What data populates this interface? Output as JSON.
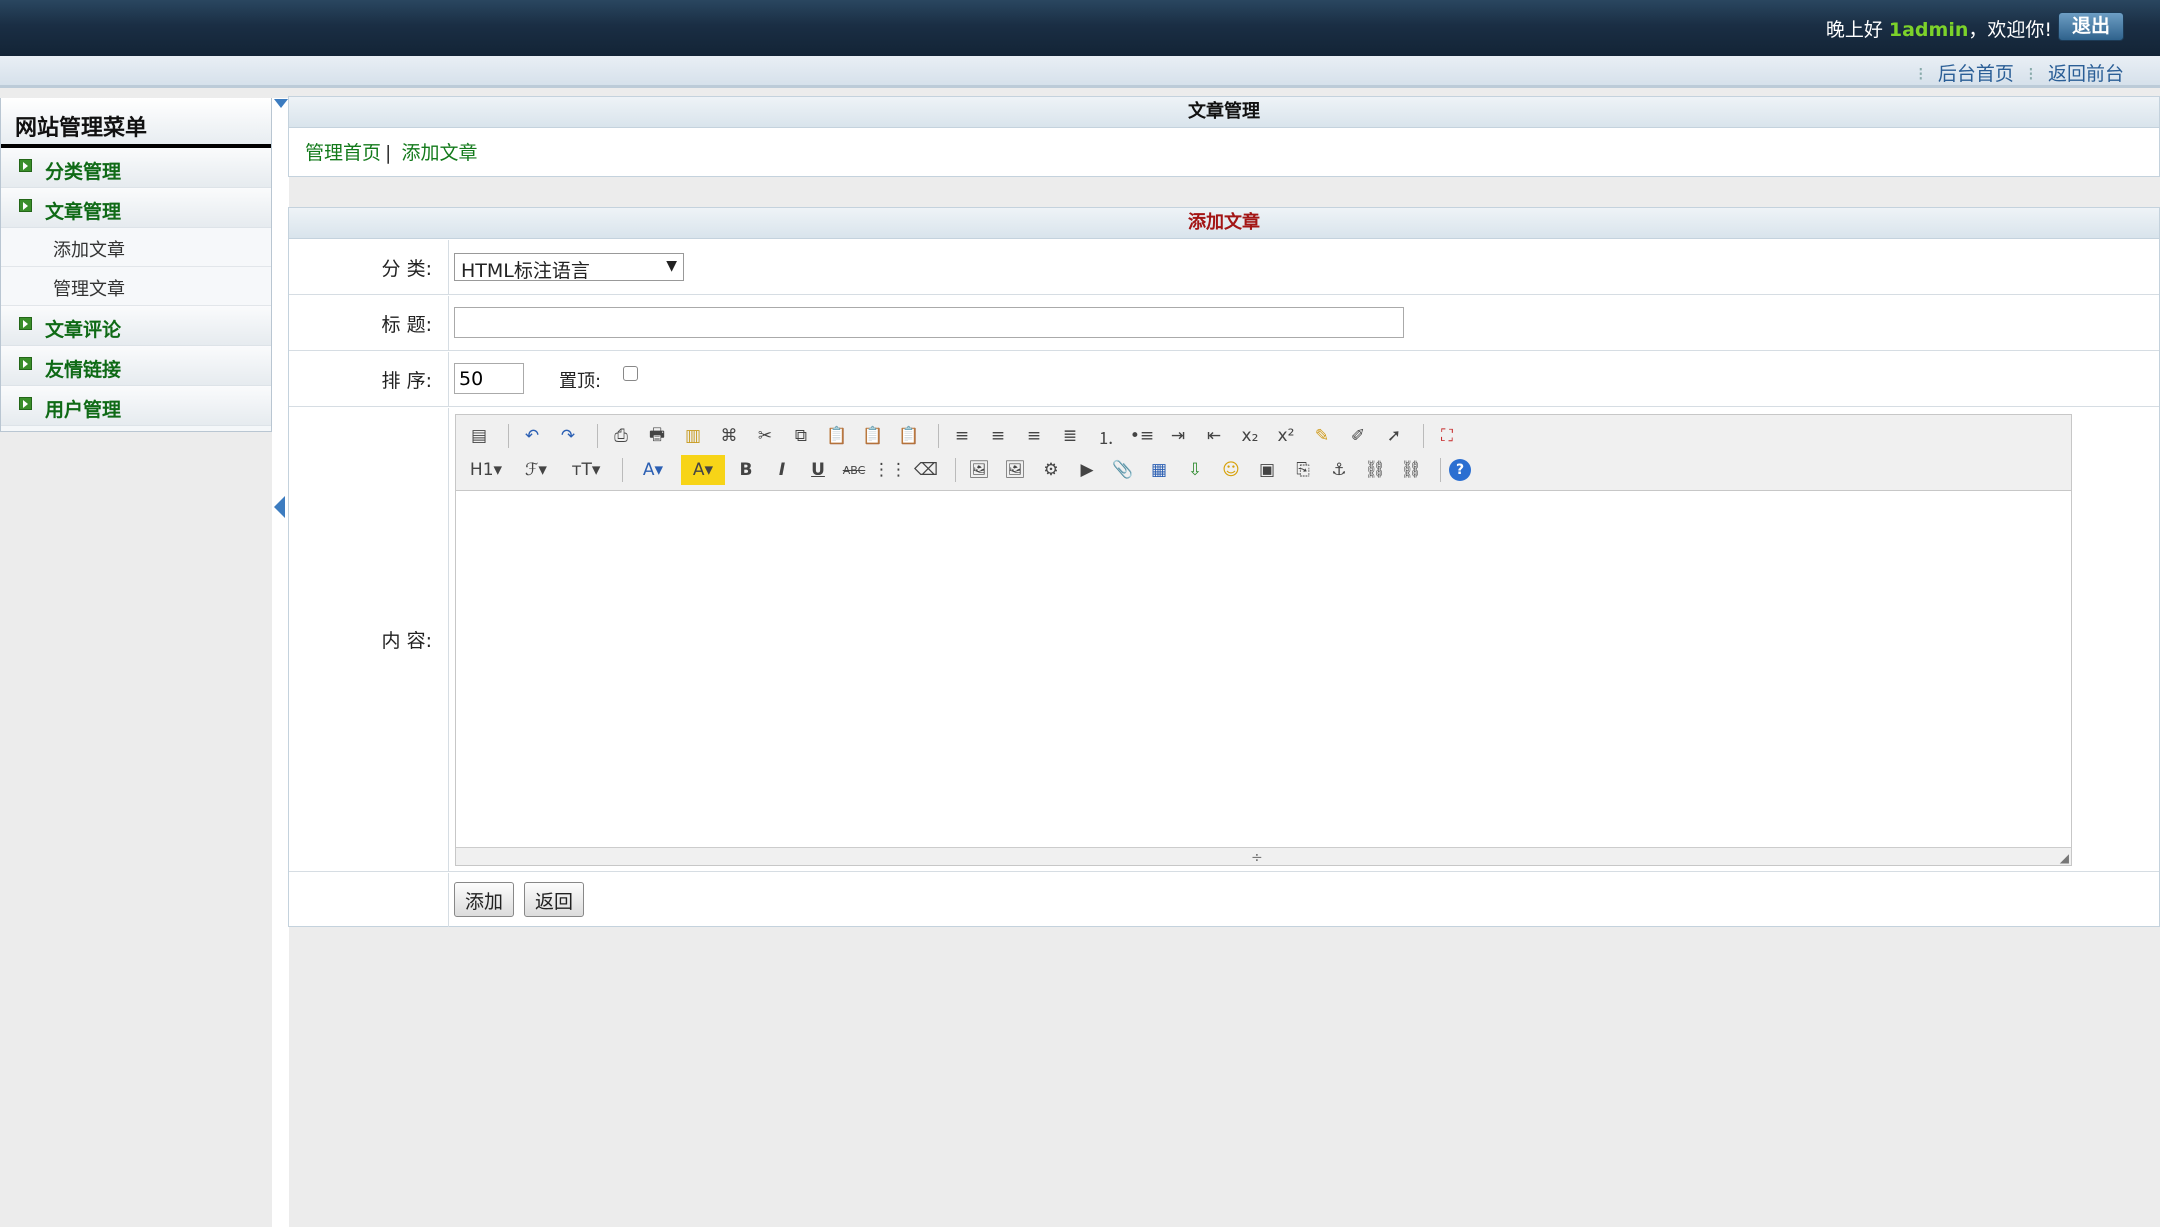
{
  "header": {
    "greeting_prefix": "晚上好",
    "username": "1admin",
    "greeting_suffix": "，欢迎你!",
    "logout_label": "退出",
    "links": [
      "后台首页",
      "返回前台"
    ]
  },
  "sidebar": {
    "title": "网站管理菜单",
    "items": [
      {
        "label": "分类管理"
      },
      {
        "label": "文章管理",
        "children": [
          "添加文章",
          "管理文章"
        ]
      },
      {
        "label": "文章评论"
      },
      {
        "label": "友情链接"
      },
      {
        "label": "用户管理"
      }
    ]
  },
  "panel1": {
    "title": "文章管理",
    "nav": [
      "管理首页",
      "添加文章"
    ],
    "nav_sep": "|"
  },
  "form": {
    "title": "添加文章",
    "category_label": "分  类:",
    "category_value": "HTML标注语言",
    "title_label": "标  题:",
    "title_value": "",
    "sort_label": "排  序:",
    "sort_value": "50",
    "top_label": "置顶:",
    "top_checked": false,
    "content_label": "内  容:",
    "submit_label": "添加",
    "back_label": "返回"
  },
  "editor": {
    "toolbar_row1": [
      "source-icon",
      "undo-icon",
      "redo-icon",
      "preview-icon",
      "print-icon",
      "template-icon",
      "code-icon",
      "cut-icon",
      "copy-icon",
      "paste-icon",
      "paste-text-icon",
      "paste-word-icon",
      "align-left-icon",
      "align-center-icon",
      "align-right-icon",
      "justify-icon",
      "ordered-list-icon",
      "unordered-list-icon",
      "indent-icon",
      "outdent-icon",
      "subscript-icon",
      "superscript-icon",
      "clear-format-icon",
      "select-all-icon",
      "cursor-icon",
      "fullscreen-icon"
    ],
    "toolbar_row2": [
      "heading-icon",
      "font-name-icon",
      "font-size-icon",
      "font-color-icon",
      "highlight-icon",
      "bold-icon",
      "italic-icon",
      "underline-icon",
      "strikethrough-icon",
      "line-height-icon",
      "eraser-icon",
      "image-icon",
      "multi-image-icon",
      "flash-icon",
      "media-icon",
      "file-icon",
      "table-icon",
      "hr-icon",
      "emoticon-icon",
      "map-icon",
      "pagebreak-icon",
      "anchor-icon",
      "link-icon",
      "unlink-icon",
      "help-icon"
    ],
    "glyphs": {
      "source": "▤",
      "undo": "↶",
      "redo": "↷",
      "preview": "⎙",
      "print": "🖶",
      "template": "▥",
      "code": "⌘",
      "cut": "✂",
      "copy": "⧉",
      "paste": "📋",
      "align_left": "≡",
      "align_center": "≡",
      "align_right": "≡",
      "justify": "≣",
      "ol": "⒈",
      "ul": "•≡",
      "indent": "⇥",
      "outdent": "⇤",
      "sub": "x₂",
      "sup": "x²",
      "brush": "✎",
      "select_all": "✐",
      "cursor": "➚",
      "fullscreen": "⛶",
      "h1": "H1▾",
      "font": "ℱ▾",
      "size": "тT▾",
      "color": "A▾",
      "hilite": "A▾",
      "bold": "B",
      "italic": "I",
      "underline": "U",
      "strike": "ABC",
      "lineh": "⋮⋮",
      "eraser": "⌫",
      "img": "🖼",
      "imgs": "🖼",
      "flash": "⚙",
      "media": "▶",
      "file": "📎",
      "table": "▦",
      "hr": "⇩",
      "smile": "☺",
      "map": "▣",
      "pagebreak": "⎘",
      "anchor": "⚓",
      "link": "⛓",
      "unlink": "⛓",
      "help": "?"
    }
  }
}
